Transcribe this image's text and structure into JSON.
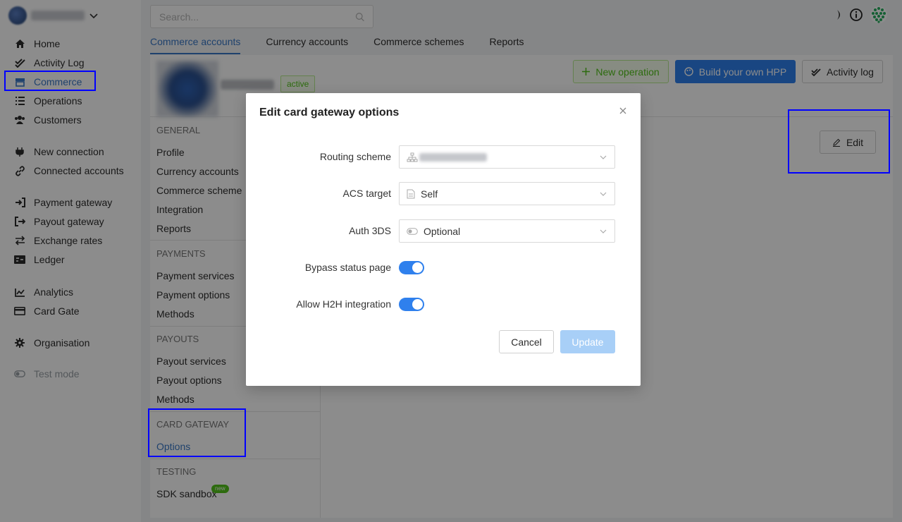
{
  "search": {
    "placeholder": "Search..."
  },
  "sidebar": {
    "items": [
      {
        "label": "Home",
        "icon": "home-icon"
      },
      {
        "label": "Activity Log",
        "icon": "double-check-icon"
      },
      {
        "label": "Commerce",
        "icon": "store-icon"
      },
      {
        "label": "Operations",
        "icon": "list-icon"
      },
      {
        "label": "Customers",
        "icon": "users-icon"
      },
      {
        "label": "New connection",
        "icon": "plug-icon"
      },
      {
        "label": "Connected accounts",
        "icon": "link-icon"
      },
      {
        "label": "Payment gateway",
        "icon": "sign-in-icon"
      },
      {
        "label": "Payout gateway",
        "icon": "sign-out-icon"
      },
      {
        "label": "Exchange rates",
        "icon": "exchange-icon"
      },
      {
        "label": "Ledger",
        "icon": "ledger-icon"
      },
      {
        "label": "Analytics",
        "icon": "chart-icon"
      },
      {
        "label": "Card Gate",
        "icon": "card-icon"
      },
      {
        "label": "Organisation",
        "icon": "gear-icon"
      },
      {
        "label": "Test mode",
        "icon": "toggle-icon"
      }
    ]
  },
  "tabs": [
    "Commerce accounts",
    "Currency accounts",
    "Commerce schemes",
    "Reports"
  ],
  "account": {
    "status": "active"
  },
  "actions": {
    "new_operation": "New operation",
    "build_hpp": "Build your own HPP",
    "activity_log": "Activity log",
    "edit": "Edit"
  },
  "submenu": {
    "general": {
      "title": "GENERAL",
      "items": [
        "Profile",
        "Currency accounts",
        "Commerce scheme",
        "Integration",
        "Reports"
      ]
    },
    "payments": {
      "title": "PAYMENTS",
      "items": [
        "Payment services",
        "Payment options",
        "Methods"
      ]
    },
    "payouts": {
      "title": "PAYOUTS",
      "items": [
        "Payout services",
        "Payout options",
        "Methods"
      ]
    },
    "card_gateway": {
      "title": "CARD GATEWAY",
      "items": [
        "Options"
      ]
    },
    "testing": {
      "title": "TESTING",
      "items": [
        "SDK sandbox"
      ],
      "badge": "new"
    }
  },
  "modal": {
    "title": "Edit card gateway options",
    "fields": {
      "routing_scheme": {
        "label": "Routing scheme",
        "value": ""
      },
      "acs_target": {
        "label": "ACS target",
        "value": "Self"
      },
      "auth_3ds": {
        "label": "Auth 3DS",
        "value": "Optional"
      },
      "bypass_status_page": {
        "label": "Bypass status page",
        "enabled": true
      },
      "allow_h2h": {
        "label": "Allow H2H integration",
        "enabled": true
      }
    },
    "cancel": "Cancel",
    "update": "Update"
  },
  "colors": {
    "accent": "#2f80ed",
    "active_link": "#3a78c6",
    "success": "#52c41a",
    "highlight": "#0000ff"
  }
}
